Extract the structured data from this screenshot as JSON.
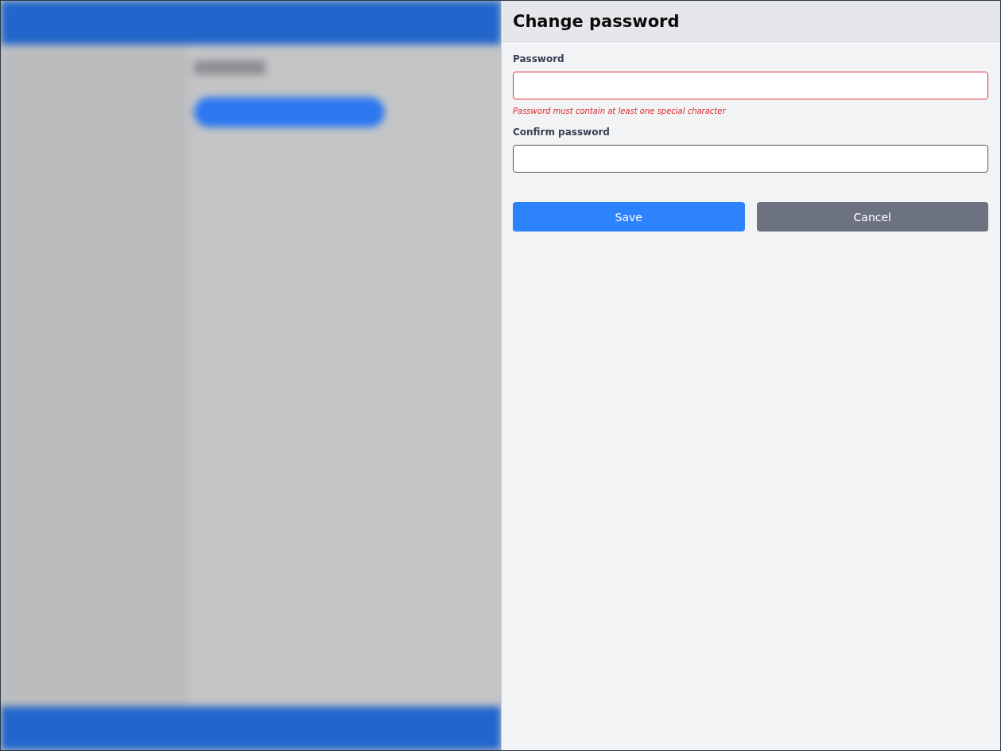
{
  "drawer": {
    "title": "Change password",
    "fields": [
      {
        "label": "Password",
        "invalid": true,
        "error": "Password must contain at least one special character"
      },
      {
        "label": "Confirm password",
        "invalid": false
      }
    ],
    "buttons": [
      {
        "label": "Save",
        "kind": "primary"
      },
      {
        "label": "Cancel",
        "kind": "secondary"
      }
    ]
  }
}
